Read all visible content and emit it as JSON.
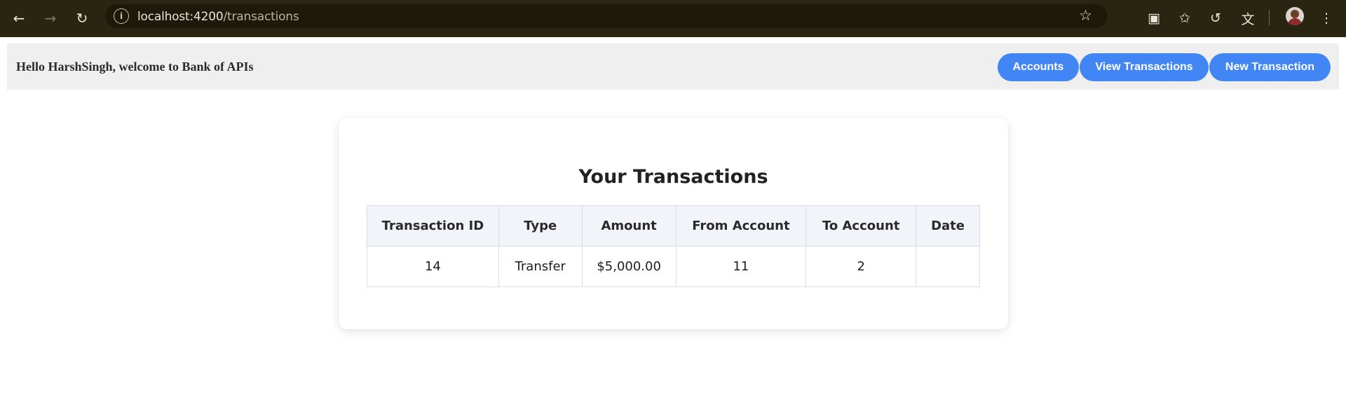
{
  "browser": {
    "url_host": "localhost:4200",
    "url_path": "/transactions",
    "icons": {
      "back": "arrow-left-icon",
      "forward": "arrow-right-icon",
      "reload": "reload-icon",
      "site_info": "info-icon",
      "bookmark": "star-icon",
      "screenshot": "camera-icon",
      "bookmarks_list": "star-list-icon",
      "history": "history-icon",
      "translate": "translate-icon",
      "menu": "kebab-menu-icon"
    }
  },
  "header": {
    "greeting": "Hello HarshSingh, welcome to Bank of APIs",
    "buttons": {
      "accounts": "Accounts",
      "view_transactions": "View Transactions",
      "new_transaction": "New Transaction"
    },
    "button_color": "#4285f4"
  },
  "main": {
    "title": "Your Transactions",
    "table": {
      "columns": [
        "Transaction ID",
        "Type",
        "Amount",
        "From Account",
        "To Account",
        "Date"
      ],
      "rows": [
        [
          "14",
          "Transfer",
          "$5,000.00",
          "11",
          "2",
          ""
        ]
      ]
    }
  }
}
